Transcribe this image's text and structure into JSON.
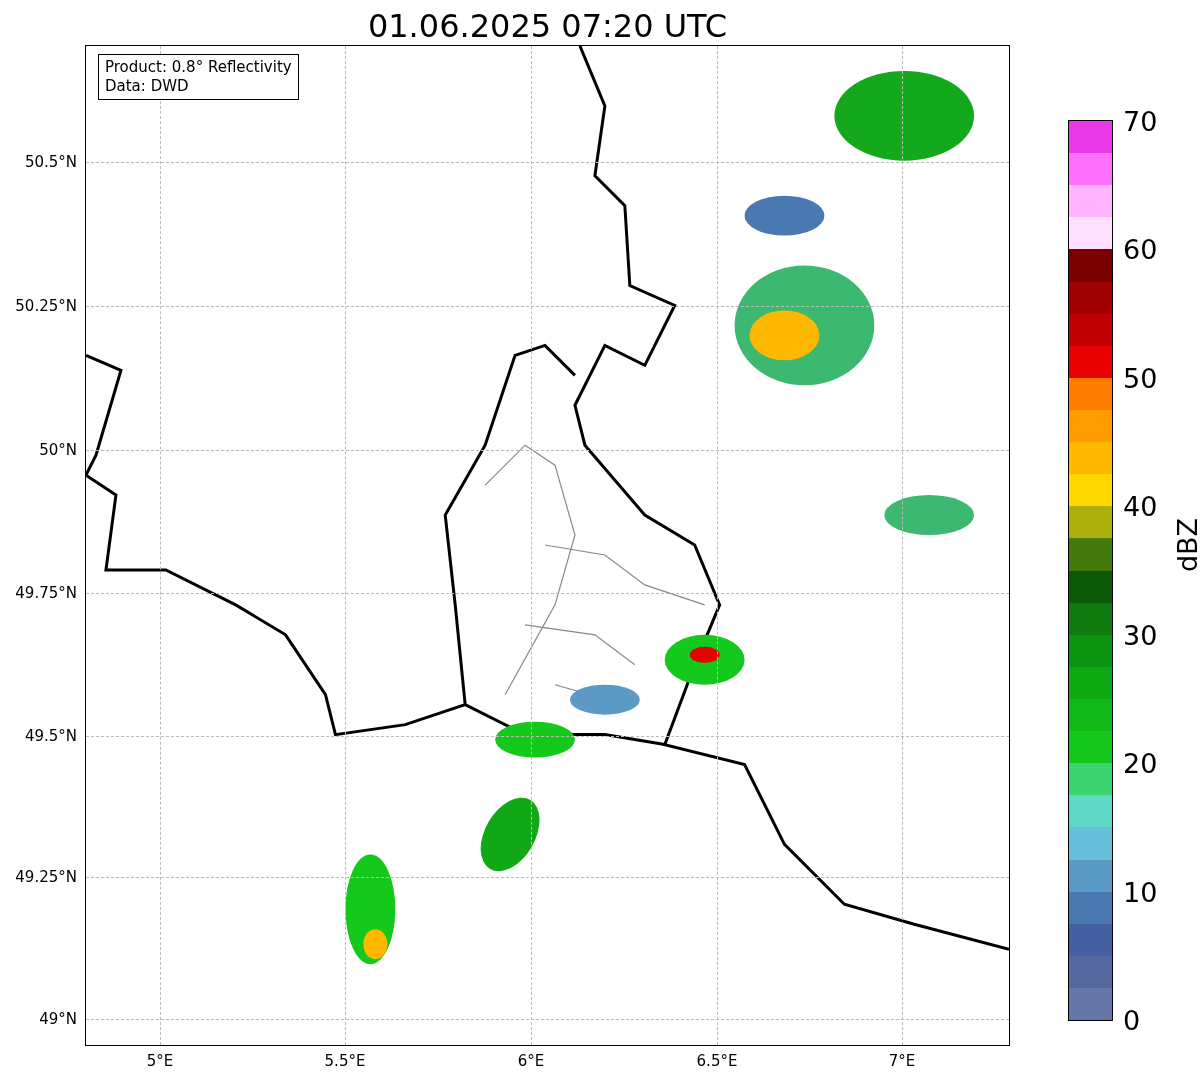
{
  "title": "01.06.2025 07:20 UTC",
  "info_box": [
    "Product: 0.8° Reflectivity",
    "Data: DWD"
  ],
  "y_ticks": [
    "50.5°N",
    "50.25°N",
    "50°N",
    "49.75°N",
    "49.5°N",
    "49.25°N",
    "49°N"
  ],
  "x_ticks": [
    "5°E",
    "5.5°E",
    "6°E",
    "6.5°E",
    "7°E"
  ],
  "colorbar": {
    "label": "dBZ",
    "ticks": [
      "70",
      "60",
      "50",
      "40",
      "30",
      "20",
      "10",
      "0"
    ],
    "levels": [
      {
        "color": "#e838e8"
      },
      {
        "color": "#ff70ff"
      },
      {
        "color": "#ffb4ff"
      },
      {
        "color": "#ffe0ff"
      },
      {
        "color": "#7a0000"
      },
      {
        "color": "#a00000"
      },
      {
        "color": "#c00000"
      },
      {
        "color": "#e80000"
      },
      {
        "color": "#ff7c00"
      },
      {
        "color": "#ff9c00"
      },
      {
        "color": "#ffb800"
      },
      {
        "color": "#ffd800"
      },
      {
        "color": "#acb00a"
      },
      {
        "color": "#447a0c"
      },
      {
        "color": "#0a5a0a"
      },
      {
        "color": "#0e7a10"
      },
      {
        "color": "#0c9410"
      },
      {
        "color": "#0ea812"
      },
      {
        "color": "#10b818"
      },
      {
        "color": "#14c81c"
      },
      {
        "color": "#3cd470"
      },
      {
        "color": "#60d8c8"
      },
      {
        "color": "#66c0dc"
      },
      {
        "color": "#5a9ac4"
      },
      {
        "color": "#4a78b0"
      },
      {
        "color": "#4560a0"
      },
      {
        "color": "#5569a0"
      },
      {
        "color": "#6776a8"
      }
    ]
  }
}
